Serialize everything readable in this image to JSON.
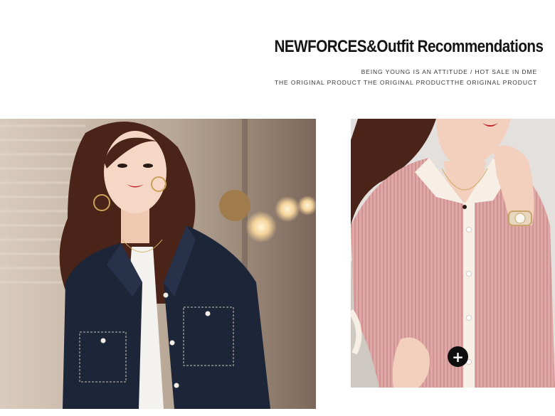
{
  "header": {
    "title": "NEWFORCES&Outfit Recommendations",
    "tagline_1": "BEING  YOUNG IS AN ATTITUDE / HOT SALE IN DME",
    "tagline_2": "THE ORIGINAL PRODUCT THE ORIGINAL PRODUCTTHE ORIGINAL PRODUCT"
  },
  "products": [
    {
      "photo": "woman-in-navy-denim-jacket",
      "background": "#c8b6a4",
      "garment_color": "#1d2538"
    },
    {
      "photo": "pink-ribbed-knit-cardigan",
      "background": "#e4e0dd",
      "garment_color": "#dfa7a5",
      "action_icon": "plus-icon",
      "action_label": "+"
    }
  ]
}
